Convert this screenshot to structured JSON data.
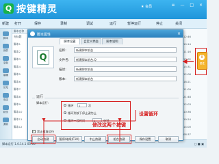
{
  "app": {
    "title": "按键精灵",
    "logo_glyph": "Q",
    "window_controls": "≡ — □ ×",
    "badge": "★ 会员"
  },
  "toolbar": {
    "items": [
      "新建",
      "打开",
      "保存",
      "录制",
      "调试",
      "运行",
      "暂停运行",
      "停止",
      "关闭"
    ]
  },
  "sidebar": {
    "items": [
      "脚本",
      "我的",
      "录制",
      "编辑",
      "论坛",
      "商店",
      "精灵",
      "源码"
    ]
  },
  "list": {
    "header": "脚本名称",
    "rows": [
      "无标题",
      "脚本1",
      "脚本2",
      "脚本3",
      "脚本4",
      "脚本5",
      "脚本6",
      "脚本7",
      "脚本8",
      "脚本9",
      "脚本10",
      "脚本11",
      "脚本12"
    ]
  },
  "time_column": {
    "values": [
      "12:46",
      "10:14",
      "11:16",
      "13:02",
      "15:31",
      "12:08",
      "18:21",
      "11:09",
      "21:48",
      "12:03",
      "10:36",
      "19:24",
      "14:00",
      "08:37"
    ]
  },
  "right_icon": {
    "glyph": "i",
    "label": "属性"
  },
  "dialog": {
    "title": "脚本属性",
    "close": "×",
    "tabs": [
      "脚本设置",
      "自定义界面",
      "脚本说明"
    ],
    "active_tab": 0,
    "icon_glyph": "Q",
    "fields": [
      {
        "label": "名称:",
        "value": "新建脚本前台"
      },
      {
        "label": "文件名:",
        "value": "新建脚本前台.Q"
      },
      {
        "label": "描述:",
        "value": "新建脚本前台"
      },
      {
        "label": "版本:",
        "value": "新建脚本前台"
      }
    ],
    "run": {
      "section_title": "运行",
      "repeat_label": "脚本运行:",
      "options": [
        {
          "text": "循环",
          "box": "1",
          "suffix": "次",
          "selected": false
        },
        {
          "text": "循环到按下停止键为止",
          "box": "",
          "suffix": "",
          "selected": true
        },
        {
          "text": "循环一段时间",
          "box": "1",
          "suffix": "分钟",
          "selected": false
        }
      ],
      "annotation": "设置循环"
    },
    "checkbox": {
      "label": "禁止重复运行",
      "checked": true
    },
    "buttons": [
      "启动热键",
      "暂停/继续(F10)",
      "中止热键",
      "组合热键",
      "保存设置",
      "取消"
    ],
    "annotation_bottom": "修改这两个按键"
  },
  "status": {
    "left": "脚本运行 1.0.14.1  00:00",
    "right": "  ▢ ■ ▣ "
  },
  "colors": {
    "accent": "#1f95da",
    "highlight": "#d62020",
    "icon_bg": "#f4b52c"
  }
}
